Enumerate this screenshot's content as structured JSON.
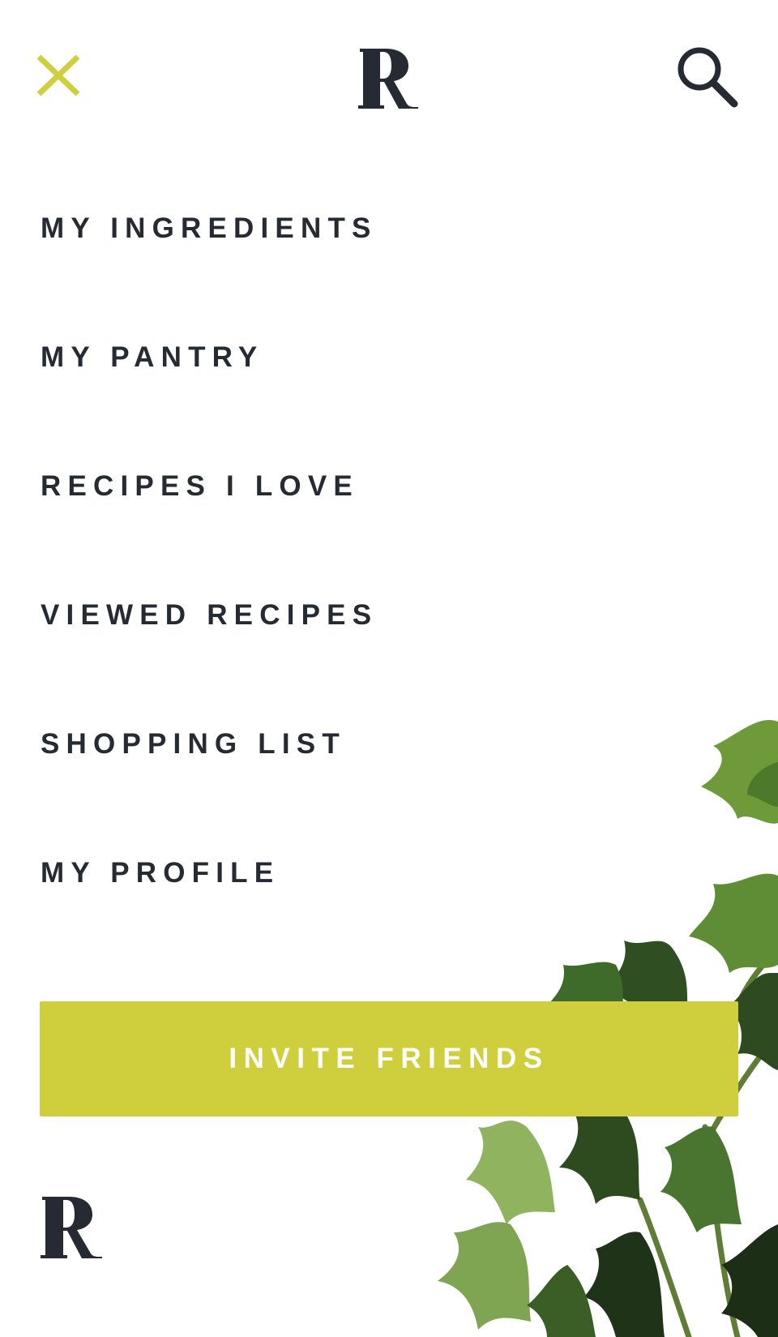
{
  "header": {
    "close_icon": "close-icon",
    "logo_icon": "brand-logo-r",
    "search_icon": "search-icon"
  },
  "menu": {
    "items": [
      {
        "label": "MY INGREDIENTS"
      },
      {
        "label": "MY PANTRY"
      },
      {
        "label": "RECIPES I LOVE"
      },
      {
        "label": "VIEWED RECIPES"
      },
      {
        "label": "SHOPPING LIST"
      },
      {
        "label": "MY PROFILE"
      }
    ]
  },
  "cta": {
    "label": "INVITE FRIENDS"
  },
  "footer": {
    "logo_icon": "brand-logo-r"
  },
  "colors": {
    "accent": "#cfcf3d",
    "text": "#262b33",
    "background": "#ffffff",
    "button_text": "#ffffff"
  }
}
